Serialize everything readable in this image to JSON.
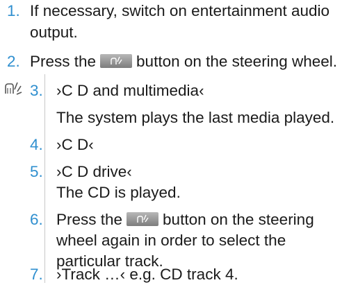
{
  "steps": [
    {
      "num": "1.",
      "lines": [
        "If necessary, switch on entertainment audio",
        "output."
      ]
    },
    {
      "num": "2.",
      "before": "Press the",
      "after": "button on the steering wheel."
    },
    {
      "num": "3.",
      "lines": [
        "›C D and multimedia‹",
        "The system plays the last media played."
      ]
    },
    {
      "num": "4.",
      "lines": [
        "›C D‹"
      ]
    },
    {
      "num": "5.",
      "lines": [
        "›C D drive‹",
        "The CD is played."
      ]
    },
    {
      "num": "6.",
      "before": "Press the",
      "after": "button on the steering",
      "lines": [
        "wheel again in order to select the",
        "particular track."
      ]
    },
    {
      "num": "7.",
      "lines": [
        "›Track …‹ e.g. CD track 4."
      ]
    }
  ],
  "icons": {
    "voice": "voice-command-icon",
    "button": "voice-button-icon"
  },
  "colors": {
    "accent": "#2f8fcf",
    "text": "#1a1a1a"
  }
}
